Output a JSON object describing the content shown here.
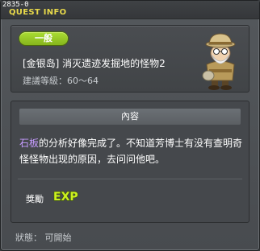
{
  "window": {
    "quest_id": "2835-0",
    "title": "QUEST INFO"
  },
  "quest": {
    "category": "一般",
    "name": "[金银岛] 消灭遗迹发掘地的怪物2",
    "level_range": "建議等級：60～64"
  },
  "content": {
    "header": "內容",
    "description_highlight": "石板",
    "description_rest": "的分析好像完成了。不知道芳博士有没有查明奇怪怪物出现的原因，去问问他吧。",
    "reward_label": "獎勵",
    "reward_icon": "exp-icon",
    "reward_icon_text": "EXP"
  },
  "status": {
    "text": "狀態： 可開始"
  },
  "colors": {
    "title": "#e8d94a",
    "badge": "#96c822",
    "highlight": "#c69cff",
    "exp": "#ccf020"
  }
}
